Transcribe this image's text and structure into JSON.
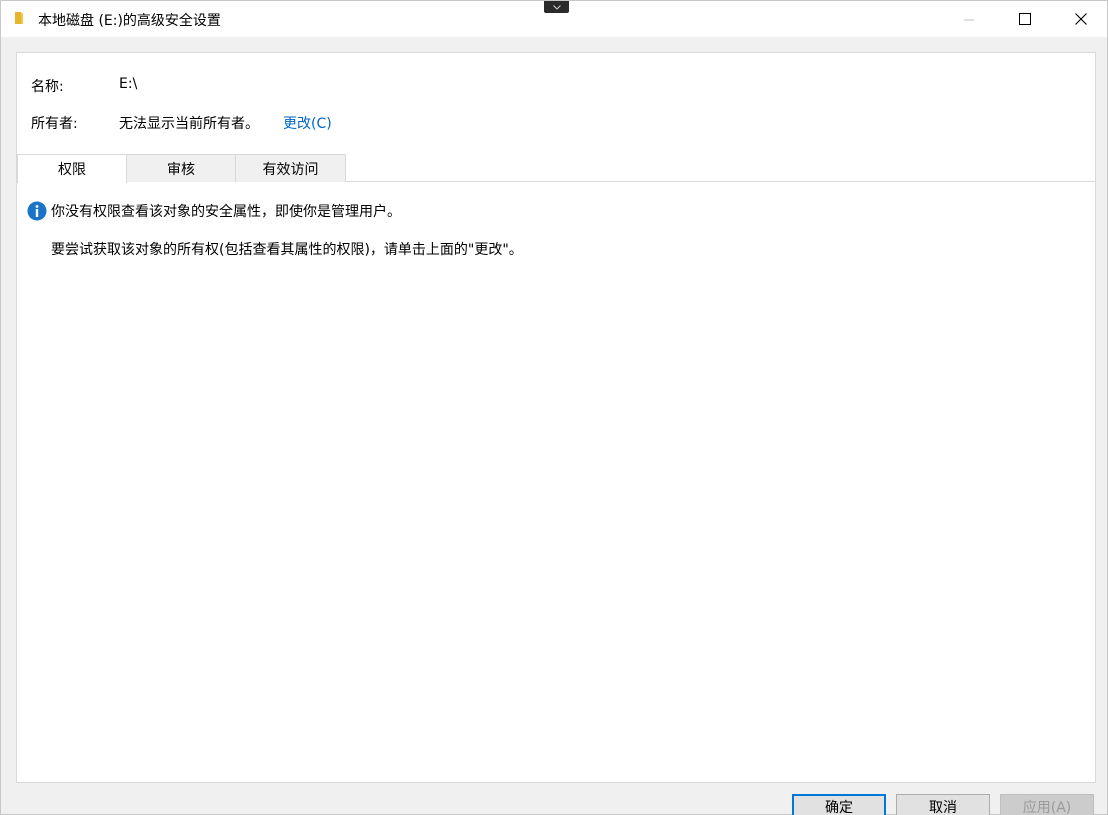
{
  "window": {
    "title": "本地磁盘 (E:)的高级安全设置"
  },
  "info": {
    "name_label": "名称:",
    "name_value": "E:\\",
    "owner_label": "所有者:",
    "owner_value": "无法显示当前所有者。",
    "change_link": "更改(C)"
  },
  "tabs": [
    {
      "label": "权限",
      "active": true
    },
    {
      "label": "审核",
      "active": false
    },
    {
      "label": "有效访问",
      "active": false
    }
  ],
  "message": {
    "line1": "你没有权限查看该对象的安全属性，即使你是管理用户。",
    "line2": "要尝试获取该对象的所有权(包括查看其属性的权限)，请单击上面的\"更改\"。"
  },
  "buttons": {
    "ok": "确定",
    "cancel": "取消",
    "apply": "应用(A)"
  },
  "colors": {
    "accent": "#0078d7",
    "link": "#0066cc",
    "folder_icon": "#f4c542",
    "info_icon": "#1a73c7"
  },
  "icons": {
    "title": "folder-icon",
    "info": "info-icon"
  }
}
